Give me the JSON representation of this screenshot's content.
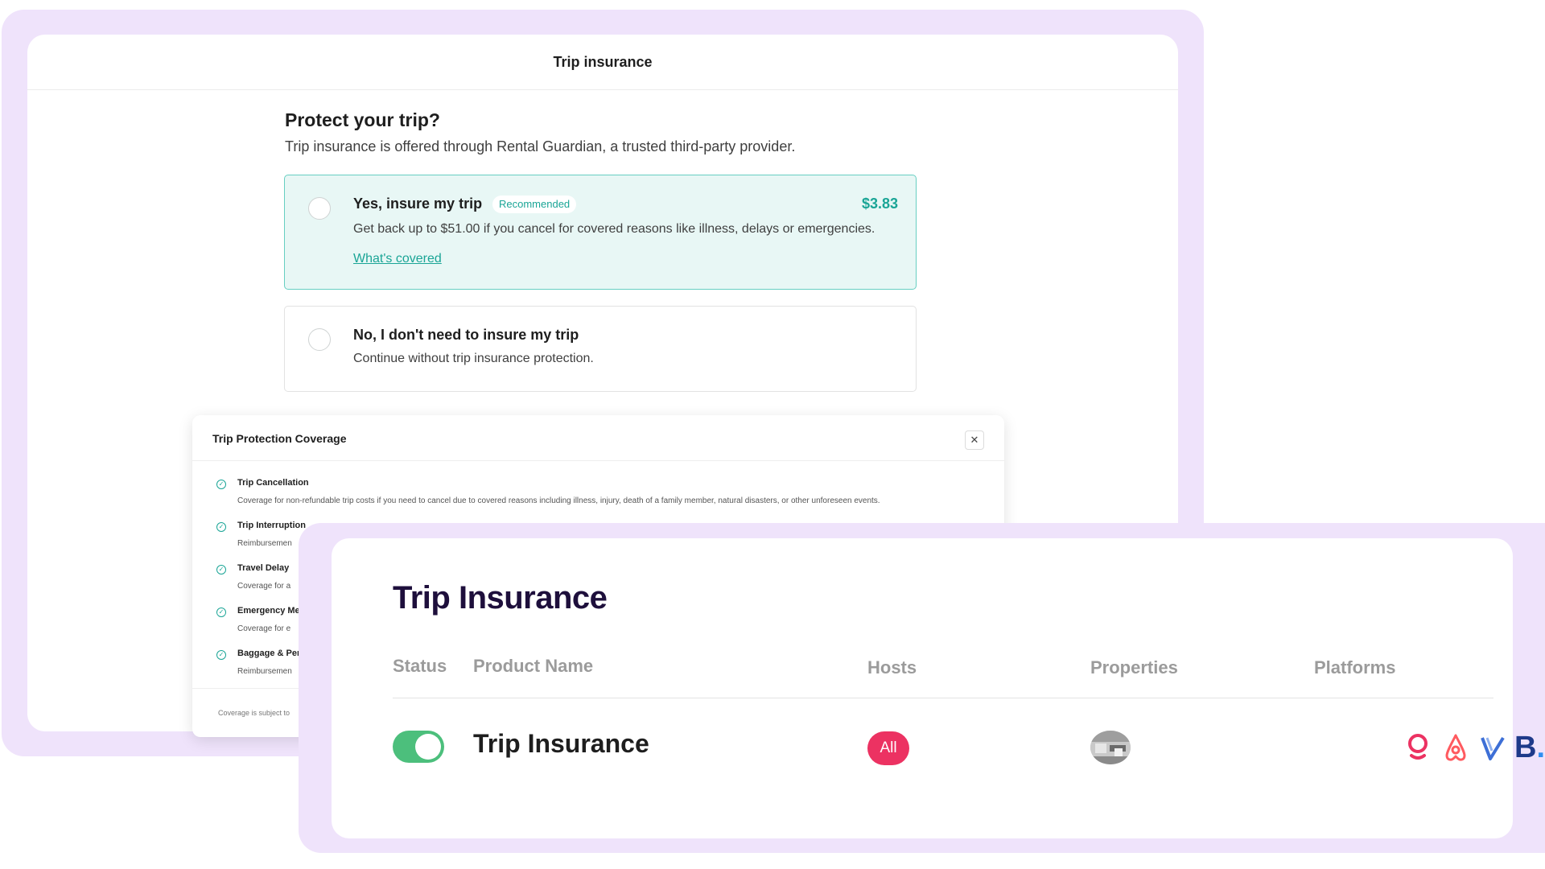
{
  "checkout": {
    "header_title": "Trip insurance",
    "heading": "Protect your trip?",
    "subheading": "Trip insurance is offered through Rental Guardian, a trusted third-party provider.",
    "option_yes": {
      "title": "Yes, insure my trip",
      "badge": "Recommended",
      "price": "$3.83",
      "description": "Get back up to $51.00 if you cancel for covered reasons like illness, delays or emergencies.",
      "link": "What's covered"
    },
    "option_no": {
      "title": "No, I don't need to insure my trip",
      "description": "Continue without trip insurance protection."
    }
  },
  "coverage_modal": {
    "title": "Trip Protection Coverage",
    "close_glyph": "✕",
    "items": [
      {
        "name": "Trip Cancellation",
        "description": "Coverage for non-refundable trip costs if you need to cancel due to covered reasons including illness, injury, death of a family member, natural disasters, or other unforeseen events."
      },
      {
        "name": "Trip Interruption",
        "description": "Reimbursemen"
      },
      {
        "name": "Travel Delay",
        "description": "Coverage for a"
      },
      {
        "name": "Emergency Me",
        "description": "Coverage for e"
      },
      {
        "name": "Baggage & Per",
        "description": "Reimbursemen"
      }
    ],
    "footnote": "Coverage is subject to"
  },
  "dashboard": {
    "title": "Trip Insurance",
    "columns": {
      "status": "Status",
      "product_name": "Product Name",
      "hosts": "Hosts",
      "properties": "Properties",
      "platforms": "Platforms"
    },
    "row": {
      "status_on": true,
      "product_name": "Trip Insurance",
      "hosts": "All",
      "platforms": [
        "map-pin-icon",
        "airbnb-icon",
        "vrbo-icon",
        "booking-com-icon",
        "fourth-platform-icon"
      ]
    },
    "colors": {
      "toggle_on": "#4cbf7c",
      "hosts_pill": "#ec3262",
      "accent_teal": "#1aa596",
      "frame_lavender": "#efe3fb"
    }
  }
}
